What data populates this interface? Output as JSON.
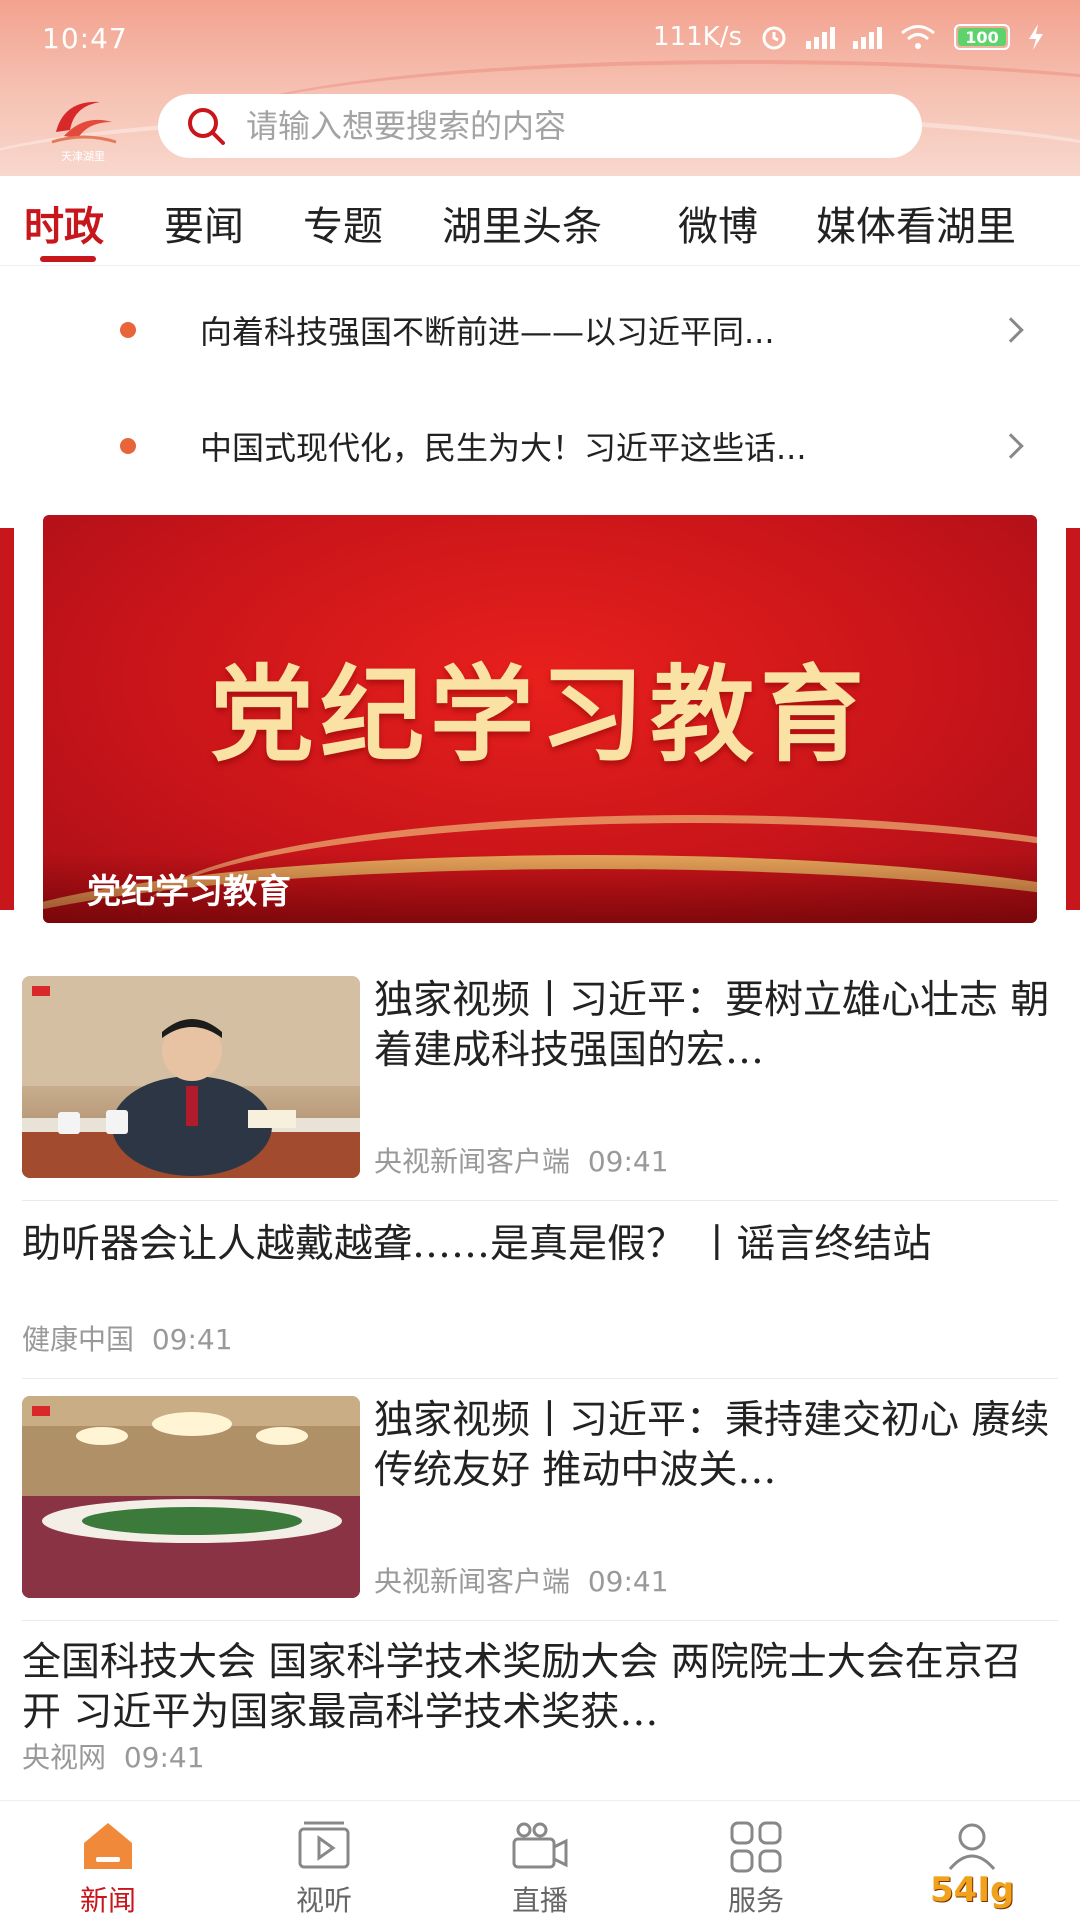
{
  "status": {
    "time": "10:47",
    "net_speed": "111K/s",
    "battery": "100"
  },
  "logo": {
    "text": "天津湖里"
  },
  "search": {
    "placeholder": "请输入想要搜索的内容"
  },
  "tabs": [
    {
      "label": "时政",
      "active": true
    },
    {
      "label": "要闻",
      "active": false
    },
    {
      "label": "专题",
      "active": false
    },
    {
      "label": "湖里头条",
      "active": false
    },
    {
      "label": "微博",
      "active": false
    },
    {
      "label": "媒体看湖里",
      "active": false
    }
  ],
  "headlines": [
    {
      "text": "向着科技强国不断前进——以习近平同..."
    },
    {
      "text": "中国式现代化，民生为大！习近平这些话..."
    }
  ],
  "banner": {
    "big_text": "党纪学习教育",
    "caption": "党纪学习教育"
  },
  "news": [
    {
      "title": "独家视频丨习近平：要树立雄心壮志 朝着建成科技强国的宏…",
      "source": "央视新闻客户端",
      "time": "09:41"
    },
    {
      "title": "助听器会让人越戴越聋……是真是假？ 丨谣言终结站",
      "source": "健康中国",
      "time": "09:41"
    },
    {
      "title": "独家视频丨习近平：秉持建交初心 赓续传统友好 推动中波关…",
      "source": "央视新闻客户端",
      "time": "09:41"
    },
    {
      "title": "全国科技大会 国家科学技术奖励大会 两院院士大会在京召开 习近平为国家最高科学技术奖获…",
      "source": "央视网",
      "time": "09:41"
    }
  ],
  "bottom_nav": [
    {
      "label": "新闻",
      "icon": "home-icon",
      "active": true
    },
    {
      "label": "视听",
      "icon": "play-video-icon",
      "active": false
    },
    {
      "label": "直播",
      "icon": "camera-icon",
      "active": false
    },
    {
      "label": "服务",
      "icon": "grid-icon",
      "active": false
    },
    {
      "label": "我的",
      "icon": "user-icon",
      "active": false
    }
  ],
  "watermark": "54Ig",
  "colors": {
    "accent": "#c8161d",
    "header_gradient_top": "#f3a28f",
    "banner_red": "#d8181c",
    "banner_gold": "#f9e2a4"
  }
}
